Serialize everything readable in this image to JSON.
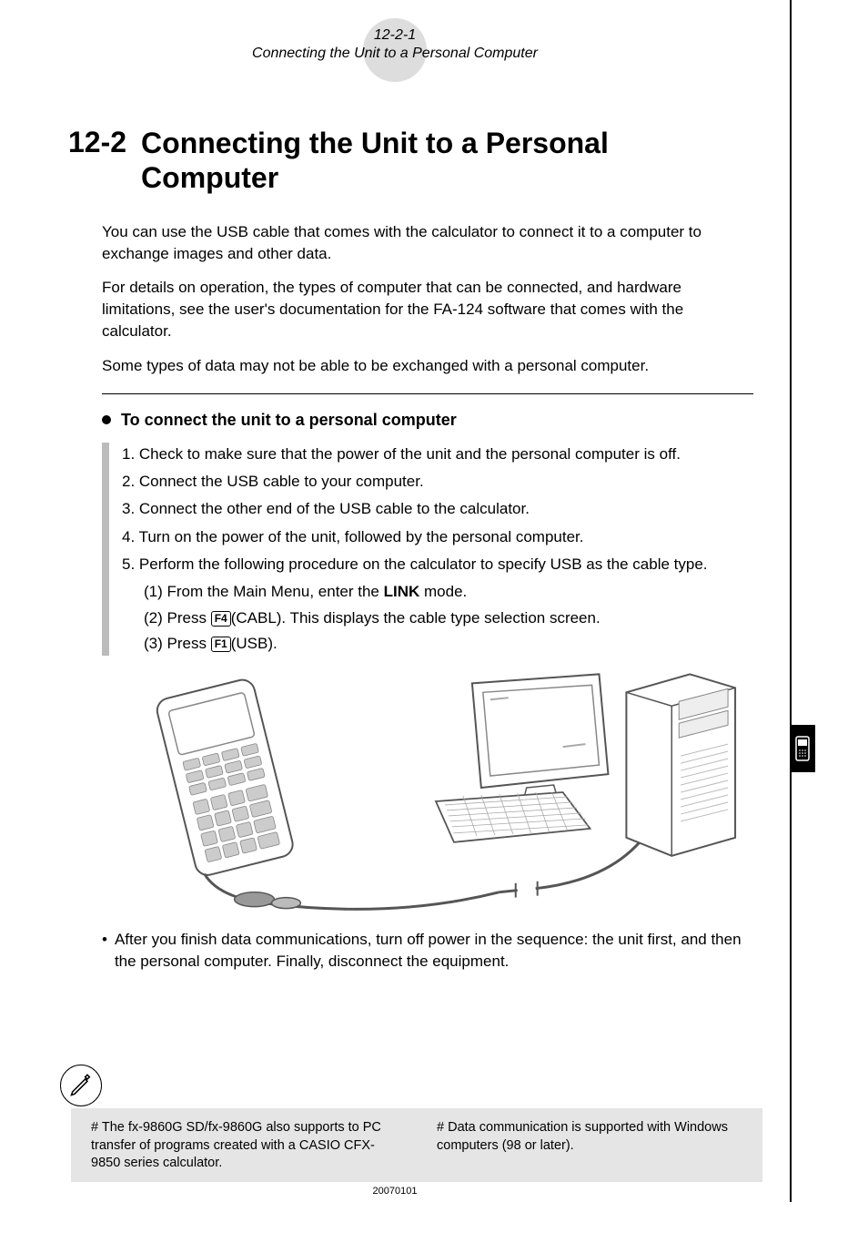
{
  "header": {
    "page_ref": "12-2-1",
    "subtitle": "Connecting the Unit to a Personal Computer"
  },
  "section": {
    "number": "12-2",
    "title": "Connecting the Unit to a Personal Computer"
  },
  "intro": {
    "p1": "You can use the USB cable that comes with the calculator to connect it to a computer to exchange images and other data.",
    "p2": "For details on operation, the types of computer that can be connected, and hardware limitations, see the user's documentation for the FA-124 software that comes with the calculator.",
    "p3": "Some types of data may not be able to be exchanged with a personal computer."
  },
  "procedure": {
    "heading": "To connect the unit to a personal computer",
    "steps": [
      "1. Check to make sure that the power of the unit and the personal computer is off.",
      "2. Connect the USB cable to your computer.",
      "3. Connect the other end of the USB cable to the calculator.",
      "4. Turn on the power of the unit, followed by the personal computer.",
      "5. Perform the following procedure on the calculator to specify USB as the cable type."
    ],
    "substeps": {
      "s1_pre": "(1) From the Main Menu, enter the ",
      "s1_bold": "LINK",
      "s1_post": " mode.",
      "s2_pre": "(2) Press ",
      "s2_key": "F4",
      "s2_post": "(CABL). This displays the cable type selection screen.",
      "s3_pre": "(3) Press ",
      "s3_key": "F1",
      "s3_post": "(USB)."
    },
    "after_note": "After you finish data communications, turn off power in the sequence: the unit first, and then the personal computer. Finally, disconnect the equipment."
  },
  "footnotes": {
    "left": "# The fx-9860G SD/fx-9860G also supports to PC transfer of programs created with a CASIO CFX-9850 series calculator.",
    "right": "# Data communication is supported with Windows computers (98 or later)."
  },
  "date_stamp": "20070101"
}
